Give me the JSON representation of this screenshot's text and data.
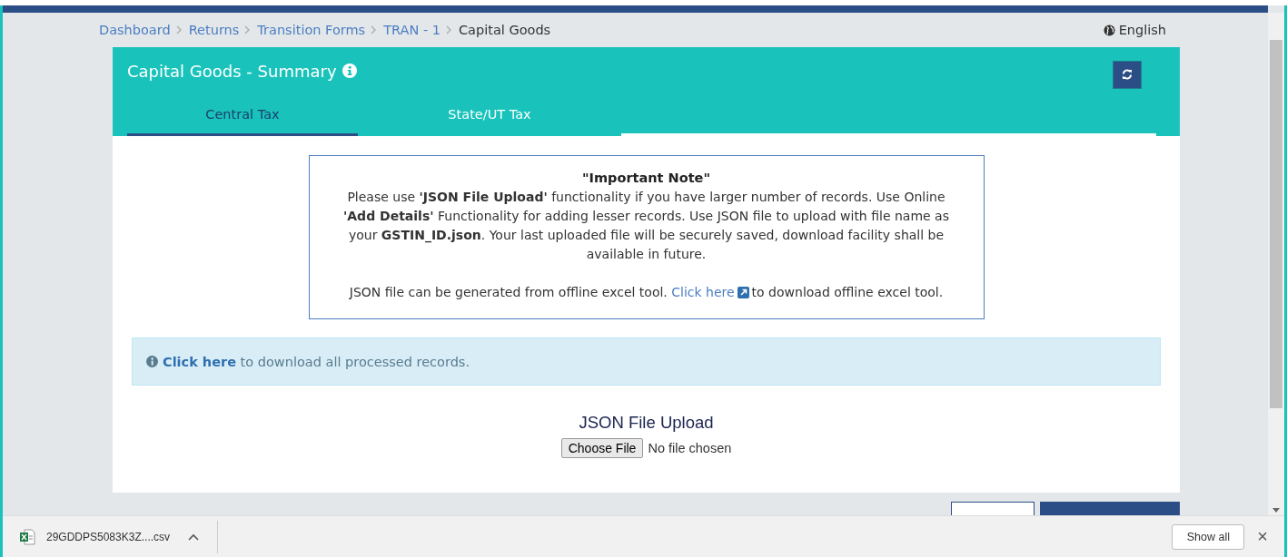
{
  "breadcrumb": [
    {
      "label": "Dashboard",
      "kind": "link"
    },
    {
      "label": "Returns",
      "kind": "link"
    },
    {
      "label": "Transition Forms",
      "kind": "link"
    },
    {
      "label": "TRAN - 1",
      "kind": "link"
    },
    {
      "label": "Capital Goods",
      "kind": "current"
    }
  ],
  "language": "English",
  "panel": {
    "title": "Capital Goods - Summary",
    "tabs": [
      {
        "label": "Central Tax",
        "selected": true
      },
      {
        "label": "State/UT Tax",
        "selected": false
      }
    ]
  },
  "note": {
    "heading": "\"Important Note\"",
    "body": "Please use **'JSON File Upload'** functionality if you have larger number of records. Use Online **'Add Details'** Functionality for adding lesser records. Use JSON file to upload with file name as your **GSTIN_ID.json**. Your last uploaded file will be securely saved, download facility shall be available in future.",
    "tool_before": "JSON file can be generated from offline excel tool.",
    "tool_link": "Click here",
    "tool_after": "to download offline excel tool."
  },
  "alert": {
    "link": "Click here",
    "text": "to download all processed records."
  },
  "upload": {
    "title": "JSON File Upload",
    "button": "Choose File",
    "status": "No file chosen"
  },
  "download_bar": {
    "file": "29GDDPS5083K3Z....csv",
    "show_all": "Show all",
    "close": "×"
  }
}
